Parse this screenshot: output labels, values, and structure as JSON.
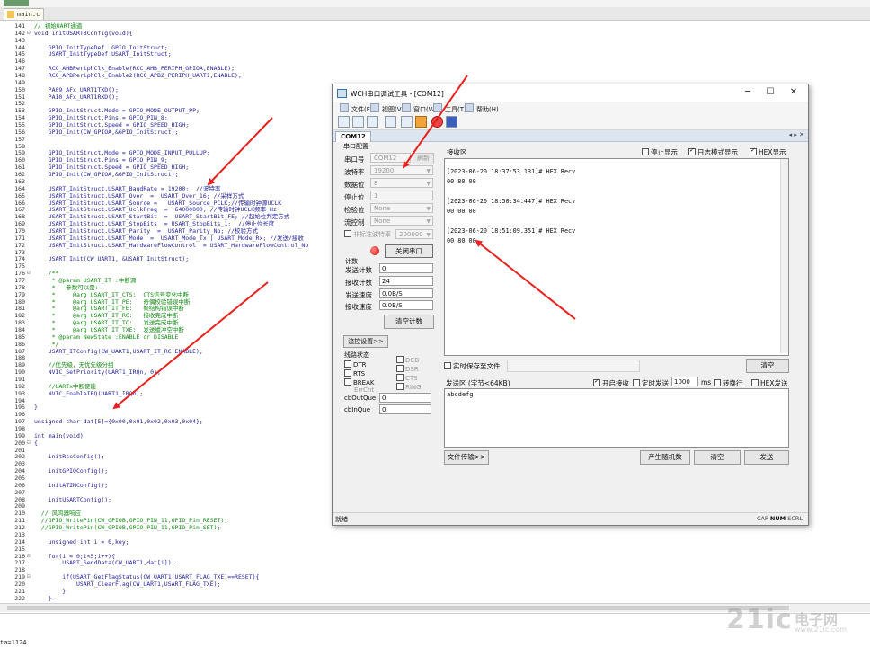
{
  "ide": {
    "file_tab": "main.c",
    "lines": [
      {
        "n": "141",
        "fold": "",
        "text": "// 初始UART通道",
        "cls": "comment"
      },
      {
        "n": "142",
        "fold": "⊟",
        "text": "void initUSART3Config(void){",
        "cls": "kw"
      },
      {
        "n": "143",
        "fold": "",
        "text": "",
        "cls": ""
      },
      {
        "n": "144",
        "fold": "",
        "text": "    GPIO_InitTypeDef  GPIO_InitStruct;",
        "cls": ""
      },
      {
        "n": "145",
        "fold": "",
        "text": "    USART_InitTypeDef USART_InitStruct;",
        "cls": ""
      },
      {
        "n": "146",
        "fold": "",
        "text": "",
        "cls": ""
      },
      {
        "n": "147",
        "fold": "",
        "text": "    RCC_AHBPeriphClk_Enable(RCC_AHB_PERIPH_GPIOA,ENABLE);",
        "cls": ""
      },
      {
        "n": "148",
        "fold": "",
        "text": "    RCC_APBPeriphClk_Enable2(RCC_APB2_PERIPH_UART1,ENABLE);",
        "cls": ""
      },
      {
        "n": "149",
        "fold": "",
        "text": "",
        "cls": ""
      },
      {
        "n": "150",
        "fold": "",
        "text": "    PA09_AFx_UART1TXD();",
        "cls": ""
      },
      {
        "n": "151",
        "fold": "",
        "text": "    PA10_AFx_UART1RXD();",
        "cls": ""
      },
      {
        "n": "152",
        "fold": "",
        "text": "",
        "cls": ""
      },
      {
        "n": "153",
        "fold": "",
        "text": "    GPIO_InitStruct.Mode = GPIO_MODE_OUTPUT_PP;",
        "cls": ""
      },
      {
        "n": "154",
        "fold": "",
        "text": "    GPIO_InitStruct.Pins = GPIO_PIN_8;",
        "cls": ""
      },
      {
        "n": "155",
        "fold": "",
        "text": "    GPIO_InitStruct.Speed = GPIO_SPEED_HIGH;",
        "cls": ""
      },
      {
        "n": "156",
        "fold": "",
        "text": "    GPIO_Init(CW_GPIOA,&GPIO_InitStruct);",
        "cls": ""
      },
      {
        "n": "157",
        "fold": "",
        "text": "",
        "cls": ""
      },
      {
        "n": "158",
        "fold": "",
        "text": "",
        "cls": ""
      },
      {
        "n": "159",
        "fold": "",
        "text": "    GPIO_InitStruct.Mode = GPIO_MODE_INPUT_PULLUP;",
        "cls": ""
      },
      {
        "n": "160",
        "fold": "",
        "text": "    GPIO_InitStruct.Pins = GPIO_PIN_9;",
        "cls": ""
      },
      {
        "n": "161",
        "fold": "",
        "text": "    GPIO_InitStruct.Speed = GPIO_SPEED_HIGH;",
        "cls": ""
      },
      {
        "n": "162",
        "fold": "",
        "text": "    GPIO_Init(CW_GPIOA,&GPIO_InitStruct);",
        "cls": ""
      },
      {
        "n": "163",
        "fold": "",
        "text": "",
        "cls": ""
      },
      {
        "n": "164",
        "fold": "",
        "text": "    USART_InitStruct.USART_BaudRate = 19200;  //波特率",
        "cls": ""
      },
      {
        "n": "165",
        "fold": "",
        "text": "    USART_InitStruct.USART_Over  =  USART_Over_16; //采样方式",
        "cls": ""
      },
      {
        "n": "166",
        "fold": "",
        "text": "    USART_InitStruct.USART_Source =   USART_Source_PCLK;//传输时钟源UCLK",
        "cls": ""
      },
      {
        "n": "167",
        "fold": "",
        "text": "    USART_InitStruct.USART_UclkFreq  =  64000000; //传输时钟UCLK频率 Hz",
        "cls": ""
      },
      {
        "n": "168",
        "fold": "",
        "text": "    USART_InitStruct.USART_StartBit  =  USART_StartBit_FE; //起始位判定方式",
        "cls": ""
      },
      {
        "n": "169",
        "fold": "",
        "text": "    USART_InitStruct.USART_StopBits  = USART_StopBits_1;  //停止位长度",
        "cls": ""
      },
      {
        "n": "170",
        "fold": "",
        "text": "    USART_InitStruct.USART_Parity  =  USART_Parity_No; //校验方式",
        "cls": ""
      },
      {
        "n": "171",
        "fold": "",
        "text": "    USART_InitStruct.USART_Mode  =  USART_Mode_Tx | USART_Mode_Rx; //发送/接收",
        "cls": ""
      },
      {
        "n": "172",
        "fold": "",
        "text": "    USART_InitStruct.USART_HardwareFlowControl  = USART_HardwareFlowControl_No",
        "cls": ""
      },
      {
        "n": "173",
        "fold": "",
        "text": "",
        "cls": ""
      },
      {
        "n": "174",
        "fold": "",
        "text": "    USART_Init(CW_UART1, &USART_InitStruct);",
        "cls": ""
      },
      {
        "n": "175",
        "fold": "",
        "text": "",
        "cls": ""
      },
      {
        "n": "176",
        "fold": "⊟",
        "text": "    /**",
        "cls": "comment"
      },
      {
        "n": "177",
        "fold": "",
        "text": "     * @param USART_IT :中断源",
        "cls": "comment"
      },
      {
        "n": "178",
        "fold": "",
        "text": "     *   参数可以是:",
        "cls": "comment"
      },
      {
        "n": "179",
        "fold": "",
        "text": "     *     @arg USART_IT_CTS:  CTS信号变化中断",
        "cls": "comment"
      },
      {
        "n": "180",
        "fold": "",
        "text": "     *     @arg USART_IT_PE:   奇偶校验错误中断",
        "cls": "comment"
      },
      {
        "n": "181",
        "fold": "",
        "text": "     *     @arg USART_IT_FE:   帧结构错误中断",
        "cls": "comment"
      },
      {
        "n": "182",
        "fold": "",
        "text": "     *     @arg USART_IT_RC:   接收完成中断",
        "cls": "comment"
      },
      {
        "n": "183",
        "fold": "",
        "text": "     *     @arg USART_IT_TC:   发送完成中断",
        "cls": "comment"
      },
      {
        "n": "184",
        "fold": "",
        "text": "     *     @arg USART_IT_TXE:  发送缓冲空中断",
        "cls": "comment"
      },
      {
        "n": "185",
        "fold": "",
        "text": "     * @param NewState :ENABLE or DISABLE",
        "cls": "comment"
      },
      {
        "n": "186",
        "fold": "",
        "text": "     */",
        "cls": "comment"
      },
      {
        "n": "187",
        "fold": "",
        "text": "    USART_ITConfig(CW_UART1,USART_IT_RC,ENABLE);",
        "cls": ""
      },
      {
        "n": "188",
        "fold": "",
        "text": "",
        "cls": ""
      },
      {
        "n": "189",
        "fold": "",
        "text": "    //优先级，无优先级分组",
        "cls": "comment"
      },
      {
        "n": "190",
        "fold": "",
        "text": "    NVIC_SetPriority(UART1_IRQn, 0);",
        "cls": ""
      },
      {
        "n": "191",
        "fold": "",
        "text": "",
        "cls": ""
      },
      {
        "n": "192",
        "fold": "",
        "text": "    //UARTx中断使能",
        "cls": "comment"
      },
      {
        "n": "193",
        "fold": "",
        "text": "    NVIC_EnableIRQ(UART1_IRQn);",
        "cls": ""
      },
      {
        "n": "194",
        "fold": "",
        "text": "",
        "cls": ""
      },
      {
        "n": "195",
        "fold": "",
        "text": "}",
        "cls": ""
      },
      {
        "n": "196",
        "fold": "",
        "text": "",
        "cls": ""
      },
      {
        "n": "197",
        "fold": "",
        "text": "unsigned char dat[5]={0x00,0x01,0x02,0x03,0x04};",
        "cls": "kw"
      },
      {
        "n": "198",
        "fold": "",
        "text": "",
        "cls": ""
      },
      {
        "n": "199",
        "fold": "",
        "text": "int main(void)",
        "cls": "kw"
      },
      {
        "n": "200",
        "fold": "⊟",
        "text": "{",
        "cls": ""
      },
      {
        "n": "201",
        "fold": "",
        "text": "",
        "cls": ""
      },
      {
        "n": "202",
        "fold": "",
        "text": "    initRccConfig();",
        "cls": ""
      },
      {
        "n": "203",
        "fold": "",
        "text": "",
        "cls": ""
      },
      {
        "n": "204",
        "fold": "",
        "text": "    initGPIOConfig();",
        "cls": ""
      },
      {
        "n": "205",
        "fold": "",
        "text": "",
        "cls": ""
      },
      {
        "n": "206",
        "fold": "",
        "text": "    initATIMConfig();",
        "cls": ""
      },
      {
        "n": "207",
        "fold": "",
        "text": "",
        "cls": ""
      },
      {
        "n": "208",
        "fold": "",
        "text": "    initUSARTConfig();",
        "cls": ""
      },
      {
        "n": "209",
        "fold": "",
        "text": "",
        "cls": ""
      },
      {
        "n": "210",
        "fold": "",
        "text": "  // 风鸣器响应",
        "cls": "comment"
      },
      {
        "n": "211",
        "fold": "",
        "text": "  //GPIO_WritePin(CW_GPIOB,GPIO_PIN_11,GPIO_Pin_RESET);",
        "cls": "comment"
      },
      {
        "n": "212",
        "fold": "",
        "text": "  //GPIO_WritePin(CW_GPIOB,GPIO_PIN_11,GPIO_Pin_SET);",
        "cls": "comment"
      },
      {
        "n": "213",
        "fold": "",
        "text": "",
        "cls": ""
      },
      {
        "n": "214",
        "fold": "",
        "text": "    unsigned int i = 0,key;",
        "cls": "kw"
      },
      {
        "n": "215",
        "fold": "",
        "text": "",
        "cls": ""
      },
      {
        "n": "216",
        "fold": "⊟",
        "text": "    for(i = 0;i<5;i++){",
        "cls": ""
      },
      {
        "n": "217",
        "fold": "",
        "text": "        USART_SendData(CW_UART1,dat[i]);",
        "cls": ""
      },
      {
        "n": "218",
        "fold": "",
        "text": "",
        "cls": ""
      },
      {
        "n": "219",
        "fold": "⊟",
        "text": "        if(USART_GetFlagStatus(CW_UART1,USART_FLAG_TXE)==RESET){",
        "cls": ""
      },
      {
        "n": "220",
        "fold": "",
        "text": "            USART_ClearFlag(CW_UART1,USART_FLAG_TXE);",
        "cls": ""
      },
      {
        "n": "221",
        "fold": "",
        "text": "        }",
        "cls": ""
      },
      {
        "n": "222",
        "fold": "",
        "text": "    }",
        "cls": ""
      }
    ],
    "output_text": "ta=1124",
    "watermark": "21ic",
    "watermark_sub": "电子网",
    "watermark_url": "www.21ic.com"
  },
  "tool": {
    "title": "WCH串口调试工具 - [COM12]",
    "caption": {
      "min": "─",
      "max": "☐",
      "close": "✕"
    },
    "menu": [
      "文件(F)",
      "视图(V)",
      "窗口(W)",
      "工具(T)",
      "帮助(H)"
    ],
    "doc_tab": "COM12",
    "doc_tab_ctrl": "◂ ▸ ✕",
    "port_group": "串口配置",
    "fields": [
      {
        "label": "串口号",
        "value": "COM12"
      },
      {
        "label": "波特率",
        "value": "19200"
      },
      {
        "label": "数据位",
        "value": "8"
      },
      {
        "label": "停止位",
        "value": "1"
      },
      {
        "label": "检验位",
        "value": "None"
      },
      {
        "label": "流控制",
        "value": "None"
      }
    ],
    "refresh": "刷新",
    "nonstd_label": "非标准波特率",
    "nonstd_value": "200000",
    "close_port": "关闭串口",
    "count_group": "计数",
    "counts": [
      {
        "label": "发送计数",
        "value": "0"
      },
      {
        "label": "接收计数",
        "value": "24"
      },
      {
        "label": "发送速度",
        "value": "0.0B/S"
      },
      {
        "label": "接收速度",
        "value": "0.0B/S"
      }
    ],
    "clear_count": "清空计数",
    "flow_btn": "流控设置>>",
    "line_status_group": "线路状态",
    "line_status": [
      "DTR",
      "RTS",
      "BREAK",
      "ErrCnt",
      "DCD",
      "DSR",
      "CTS",
      "RING"
    ],
    "cbout_label": "cbOutQue",
    "cbout_value": "0",
    "cbin_label": "cbInQue",
    "cbin_value": "0",
    "recv_title": "接收区",
    "recv_opts": [
      "停止显示",
      "日志模式显示",
      "HEX显示"
    ],
    "recv_lines": [
      "[2023-06-20 18:37:53.131]# HEX Recv",
      "00 80 00",
      "",
      "[2023-06-20 18:50:34.447]# HEX Recv",
      "00 00 00",
      "",
      "[2023-06-20 18:51:09.351]# HEX Recv",
      "00 80 00"
    ],
    "rt_save": "实时保存至文件",
    "recv_clear": "清空",
    "send_title": "发送区 (字节<64KB)",
    "send_opts": [
      "开启接收",
      "定时发送",
      "ms",
      "转换行",
      "HEX发送"
    ],
    "interval": "1000",
    "send_text": "abcdefg",
    "file_transfer": "文件传输>>",
    "random_btn": "产生随机数",
    "send_clear": "清空",
    "send_btn": "发送",
    "status_left": "就绪",
    "status_caps": "CAP",
    "status_num": "NUM",
    "status_scrl": "SCRL"
  },
  "colors": {
    "arrow": "#e8201e",
    "comment": "#0f8c0f",
    "code": "#1f1f9a",
    "led": "#d40000"
  }
}
